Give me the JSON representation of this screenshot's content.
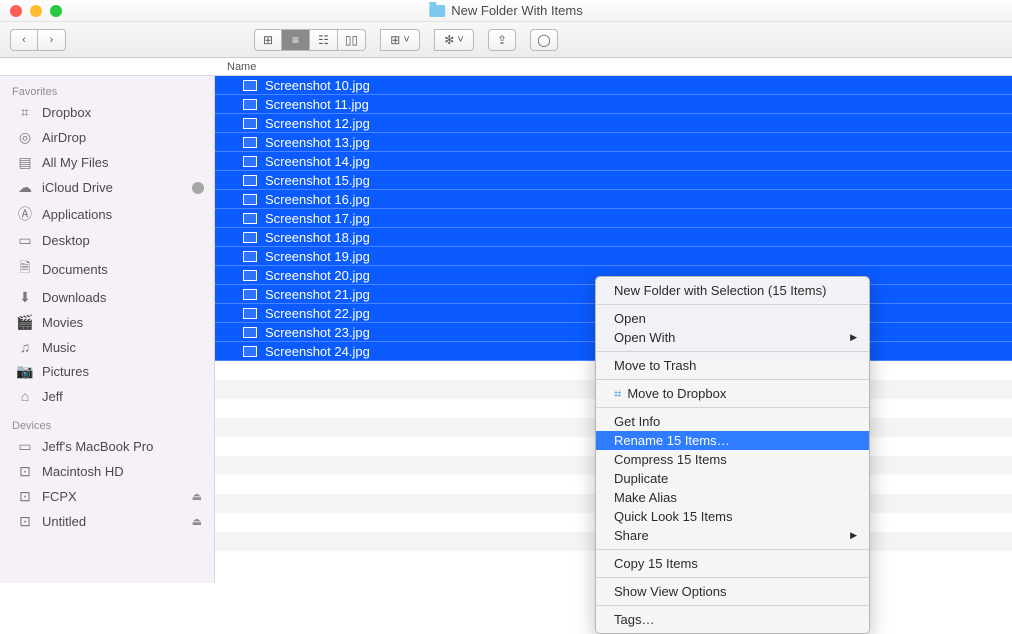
{
  "window": {
    "title": "New Folder With Items"
  },
  "toolbar": {
    "back": "‹",
    "forward": "›",
    "view_icons": "⊞",
    "view_list": "≡",
    "view_columns": "☷",
    "view_gallery": "▯▯",
    "arrange": "⊞",
    "arrange_chev": "˅",
    "action": "✻",
    "action_chev": "˅",
    "share": "⇪",
    "tags": "◯"
  },
  "columns": {
    "name": "Name"
  },
  "sidebar": {
    "favorites_label": "Favorites",
    "favorites": [
      {
        "icon": "⌗",
        "label": "Dropbox"
      },
      {
        "icon": "◎",
        "label": "AirDrop"
      },
      {
        "icon": "▤",
        "label": "All My Files"
      },
      {
        "icon": "☁",
        "label": "iCloud Drive",
        "dot": true
      },
      {
        "icon": "Ⓐ",
        "label": "Applications"
      },
      {
        "icon": "▭",
        "label": "Desktop"
      },
      {
        "icon": "🗎",
        "label": "Documents"
      },
      {
        "icon": "⬇",
        "label": "Downloads"
      },
      {
        "icon": "🎬",
        "label": "Movies"
      },
      {
        "icon": "♫",
        "label": "Music"
      },
      {
        "icon": "📷",
        "label": "Pictures"
      },
      {
        "icon": "⌂",
        "label": "Jeff"
      }
    ],
    "devices_label": "Devices",
    "devices": [
      {
        "icon": "▭",
        "label": "Jeff's MacBook Pro"
      },
      {
        "icon": "⊡",
        "label": "Macintosh HD"
      },
      {
        "icon": "⊡",
        "label": "FCPX",
        "eject": true
      },
      {
        "icon": "⊡",
        "label": "Untitled",
        "eject": true
      }
    ]
  },
  "files": [
    "Screenshot 10.jpg",
    "Screenshot 11.jpg",
    "Screenshot 12.jpg",
    "Screenshot 13.jpg",
    "Screenshot 14.jpg",
    "Screenshot 15.jpg",
    "Screenshot 16.jpg",
    "Screenshot 17.jpg",
    "Screenshot 18.jpg",
    "Screenshot 19.jpg",
    "Screenshot 20.jpg",
    "Screenshot 21.jpg",
    "Screenshot 22.jpg",
    "Screenshot 23.jpg",
    "Screenshot 24.jpg"
  ],
  "blank_rows": 11,
  "context_menu": {
    "new_folder": "New Folder with Selection (15 Items)",
    "open": "Open",
    "open_with": "Open With",
    "move_trash": "Move to Trash",
    "move_dropbox": "Move to Dropbox",
    "get_info": "Get Info",
    "rename": "Rename 15 Items…",
    "compress": "Compress 15 Items",
    "duplicate": "Duplicate",
    "make_alias": "Make Alias",
    "quick_look": "Quick Look 15 Items",
    "share": "Share",
    "copy": "Copy 15 Items",
    "view_options": "Show View Options",
    "tags": "Tags…"
  }
}
